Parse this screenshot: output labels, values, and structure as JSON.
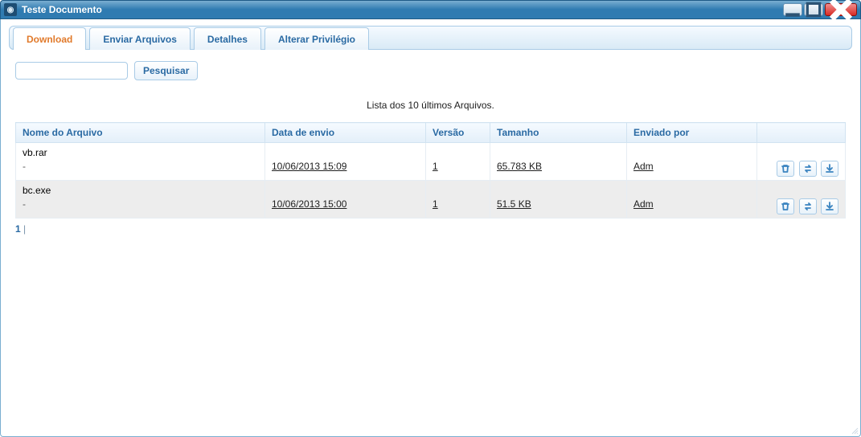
{
  "window": {
    "title": "Teste Documento",
    "minimize_icon": "minimize-icon",
    "maximize_icon": "maximize-icon",
    "close_icon": "close-icon"
  },
  "tabs": [
    {
      "label": "Download",
      "active": true
    },
    {
      "label": "Enviar Arquivos",
      "active": false
    },
    {
      "label": "Detalhes",
      "active": false
    },
    {
      "label": "Alterar Privilégio",
      "active": false
    }
  ],
  "search": {
    "value": "",
    "placeholder": "",
    "button_label": "Pesquisar"
  },
  "caption": "Lista dos 10 últimos Arquivos.",
  "columns": {
    "name": "Nome do Arquivo",
    "date": "Data de envio",
    "version": "Versão",
    "size": "Tamanho",
    "by": "Enviado por",
    "actions": ""
  },
  "rows": [
    {
      "name": "vb.rar",
      "name_sub": "-",
      "date": "10/06/2013 15:09",
      "version": "1",
      "size": "65.783 KB",
      "by": "Adm"
    },
    {
      "name": "bc.exe",
      "name_sub": "-",
      "date": "10/06/2013 15:00",
      "version": "1",
      "size": "51.5 KB",
      "by": "Adm"
    }
  ],
  "row_action_icons": {
    "delete": "trash-icon",
    "replace": "swap-icon",
    "download": "download-icon"
  },
  "pager": {
    "page": "1",
    "separator": "|"
  }
}
